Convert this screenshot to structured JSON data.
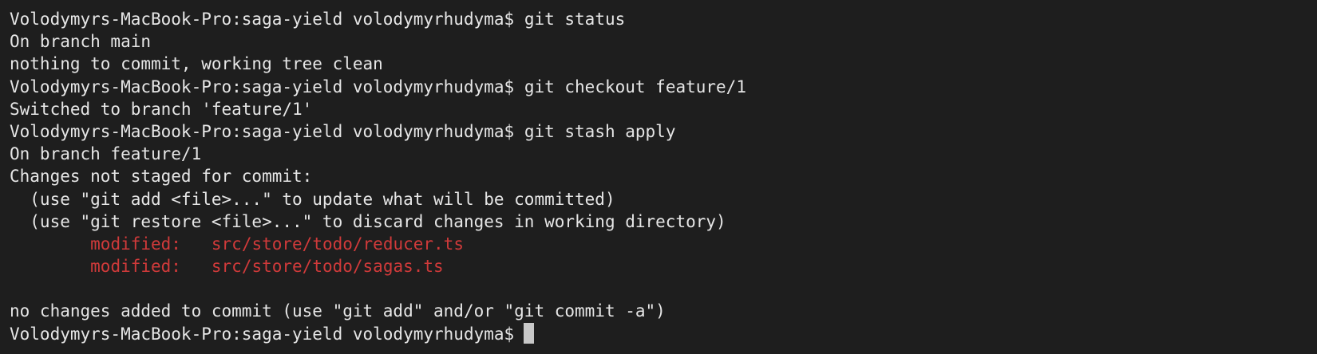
{
  "theme": {
    "background": "#1e1e1e",
    "text": "#e6e6e6",
    "modified": "#d03a3a",
    "cursor": "#c8c8c8"
  },
  "lines": [
    {
      "kind": "prompt",
      "prompt": "Volodymyrs-MacBook-Pro:saga-yield volodymyrhudyma$",
      "command": "git status"
    },
    {
      "kind": "output",
      "text": "On branch main"
    },
    {
      "kind": "output",
      "text": "nothing to commit, working tree clean"
    },
    {
      "kind": "prompt",
      "prompt": "Volodymyrs-MacBook-Pro:saga-yield volodymyrhudyma$",
      "command": "git checkout feature/1"
    },
    {
      "kind": "output",
      "text": "Switched to branch 'feature/1'"
    },
    {
      "kind": "prompt",
      "prompt": "Volodymyrs-MacBook-Pro:saga-yield volodymyrhudyma$",
      "command": "git stash apply"
    },
    {
      "kind": "output",
      "text": "On branch feature/1"
    },
    {
      "kind": "output",
      "text": "Changes not staged for commit:"
    },
    {
      "kind": "output",
      "text": "  (use \"git add <file>...\" to update what will be committed)"
    },
    {
      "kind": "output",
      "text": "  (use \"git restore <file>...\" to discard changes in working directory)"
    },
    {
      "kind": "modified",
      "label": "modified:",
      "path": "src/store/todo/reducer.ts"
    },
    {
      "kind": "modified",
      "label": "modified:",
      "path": "src/store/todo/sagas.ts"
    },
    {
      "kind": "blank"
    },
    {
      "kind": "output",
      "text": "no changes added to commit (use \"git add\" and/or \"git commit -a\")"
    },
    {
      "kind": "prompt",
      "prompt": "Volodymyrs-MacBook-Pro:saga-yield volodymyrhudyma$",
      "command": "",
      "cursor": true
    }
  ]
}
